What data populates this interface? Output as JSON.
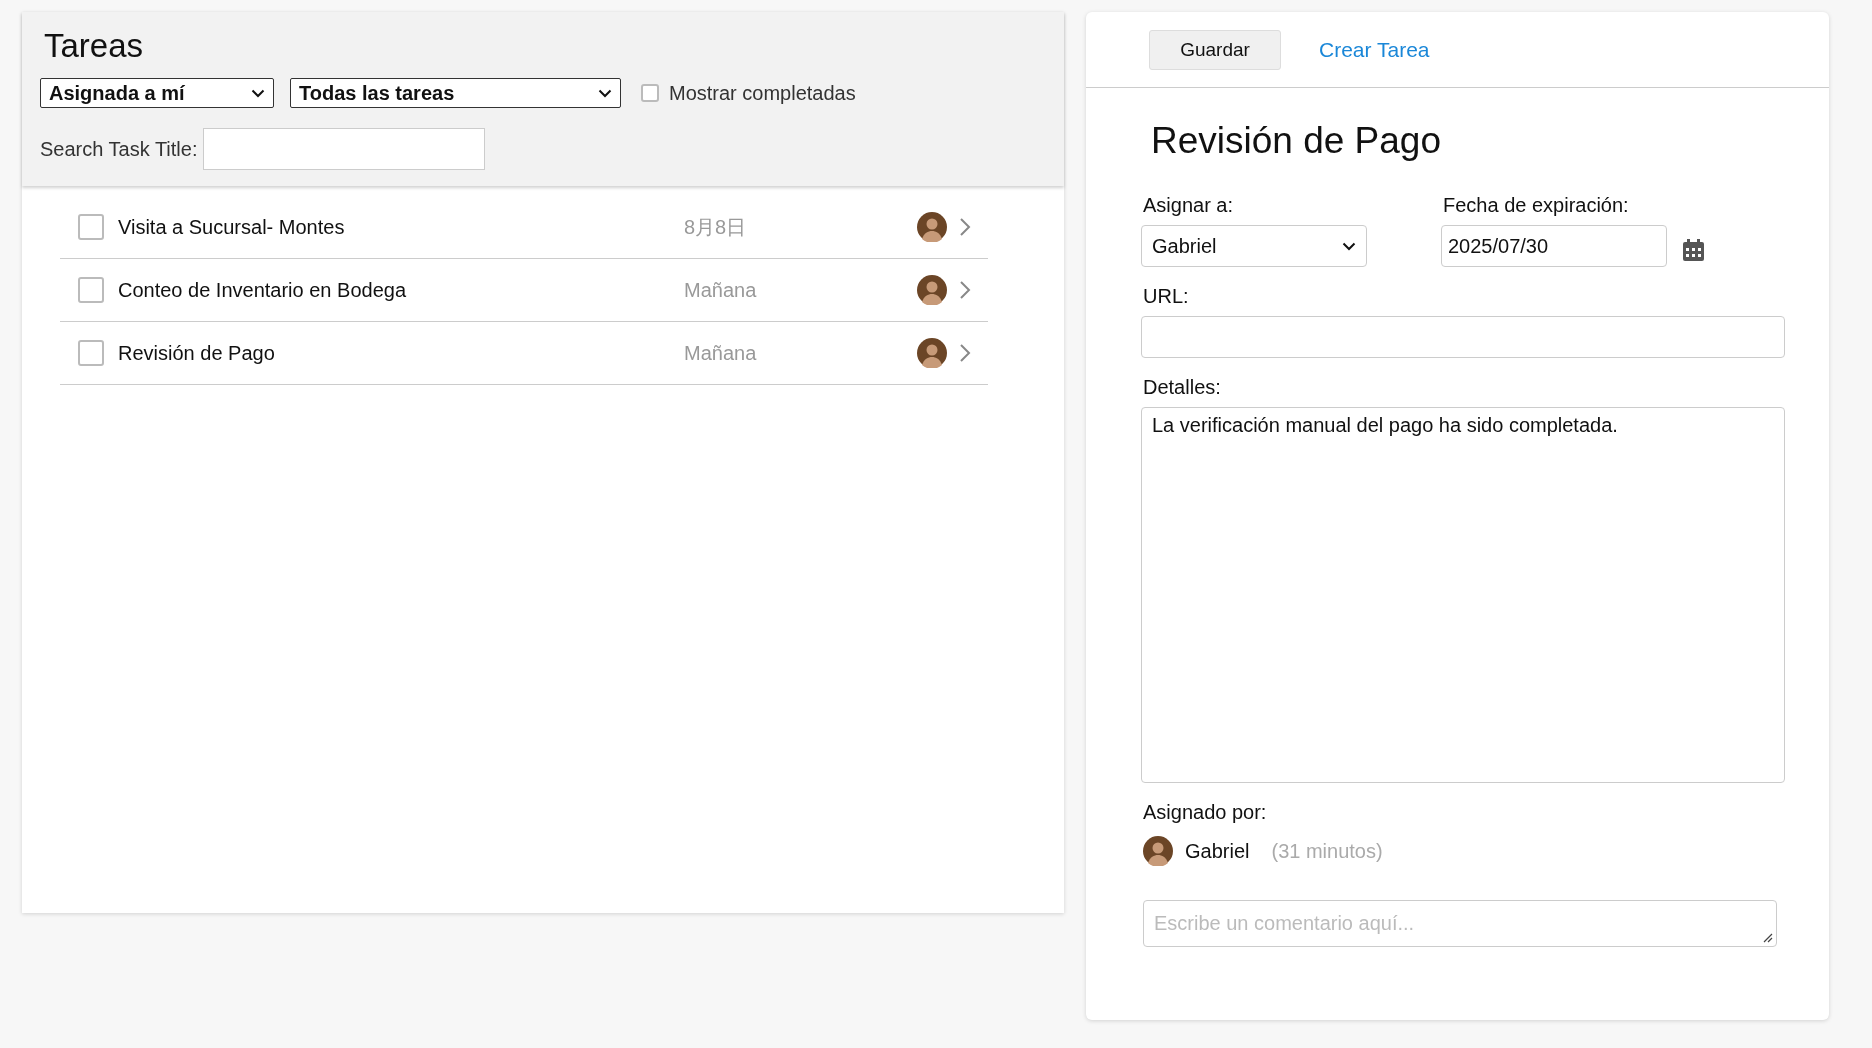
{
  "tasks_panel": {
    "title": "Tareas",
    "assignee_filter": "Asignada a mí",
    "scope_filter": "Todas las tareas",
    "show_completed": {
      "label": "Mostrar completadas",
      "checked": false
    },
    "search": {
      "label": "Search Task Title:"
    }
  },
  "tasks": [
    {
      "title": "Visita a Sucursal- Montes",
      "due": "8月8日",
      "checked": false
    },
    {
      "title": "Conteo de Inventario en Bodega",
      "due": "Mañana",
      "checked": false
    },
    {
      "title": "Revisión de Pago",
      "due": "Mañana",
      "checked": false
    }
  ],
  "detail": {
    "toolbar": {
      "save": "Guardar",
      "create": "Crear Tarea"
    },
    "title": "Revisión de Pago",
    "assign_label": "Asignar a:",
    "assignee": "Gabriel",
    "due_label": "Fecha de expiración:",
    "due_date": "2025/07/30",
    "url_label": "URL:",
    "details_label": "Detalles:",
    "details": "La verificación manual del pago ha sido completada.",
    "assigned_by_label": "Asignado por:",
    "assigned_by": "Gabriel",
    "assigned_ago": "(31 minutos)",
    "comment": {
      "placeholder": "Escribe un comentario aquí..."
    }
  }
}
